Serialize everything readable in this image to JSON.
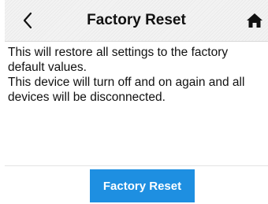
{
  "header": {
    "title": "Factory Reset",
    "back_icon": "chevron-left-icon",
    "home_icon": "home-icon"
  },
  "message": {
    "line1": "This will restore all settings to the factory default values.",
    "line2": "This device will turn off and on again and all devices will be disconnected."
  },
  "footer": {
    "button_label": "Factory Reset"
  },
  "colors": {
    "accent": "#1e8fe1",
    "header_bg": "#f3f3f3",
    "text": "#111111"
  }
}
